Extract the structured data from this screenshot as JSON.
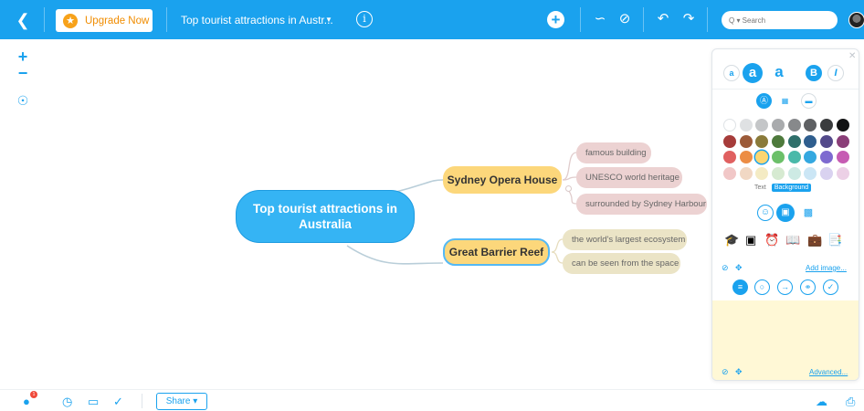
{
  "topbar": {
    "upgrade_label": "Upgrade Now",
    "doc_title": "Top tourist attractions in Austr...",
    "search_placeholder": "Q ▾ Search",
    "accent": "#1aa2ee"
  },
  "mindmap": {
    "central": "Top tourist attractions in Australia",
    "branches": [
      {
        "label": "Sydney Opera House",
        "children": [
          "famous building",
          "UNESCO world heritage",
          "surrounded by Sydney Harbour"
        ]
      },
      {
        "label": "Great Barrier Reef",
        "children": [
          "the world's largest ecosystem",
          "can be seen from the space"
        ]
      }
    ]
  },
  "panel": {
    "text_tab": "Text",
    "background_tab": "Background",
    "add_image_label": "Add image...",
    "advanced_label": "Advanced...",
    "format_small_a": "a",
    "format_mid_a": "a",
    "format_large_a": "a",
    "bold_label": "B",
    "italic_label": "I",
    "palette": [
      "#ffffff",
      "#dfe1e3",
      "#c4c6c8",
      "#a9abad",
      "#87898b",
      "#5e6063",
      "#3a3c3e",
      "#121314",
      "#a63c3a",
      "#9c5b39",
      "#8a7a3a",
      "#4e7a3c",
      "#2f6f6a",
      "#2f5e8e",
      "#534a8a",
      "#8a3e78",
      "#e06060",
      "#ec8d45",
      "#fbd671",
      "#6cc069",
      "#49b9a9",
      "#34a8e0",
      "#7e6ad0",
      "#c65cb3",
      "#f1c7c7",
      "#f1d8c4",
      "#f4ebc4",
      "#d6ead1",
      "#cdeae4",
      "#cbe6f5",
      "#d9d2f0",
      "#ecd0e6"
    ]
  },
  "bottombar": {
    "share_label": "Share ▾",
    "notification_count": "1"
  }
}
